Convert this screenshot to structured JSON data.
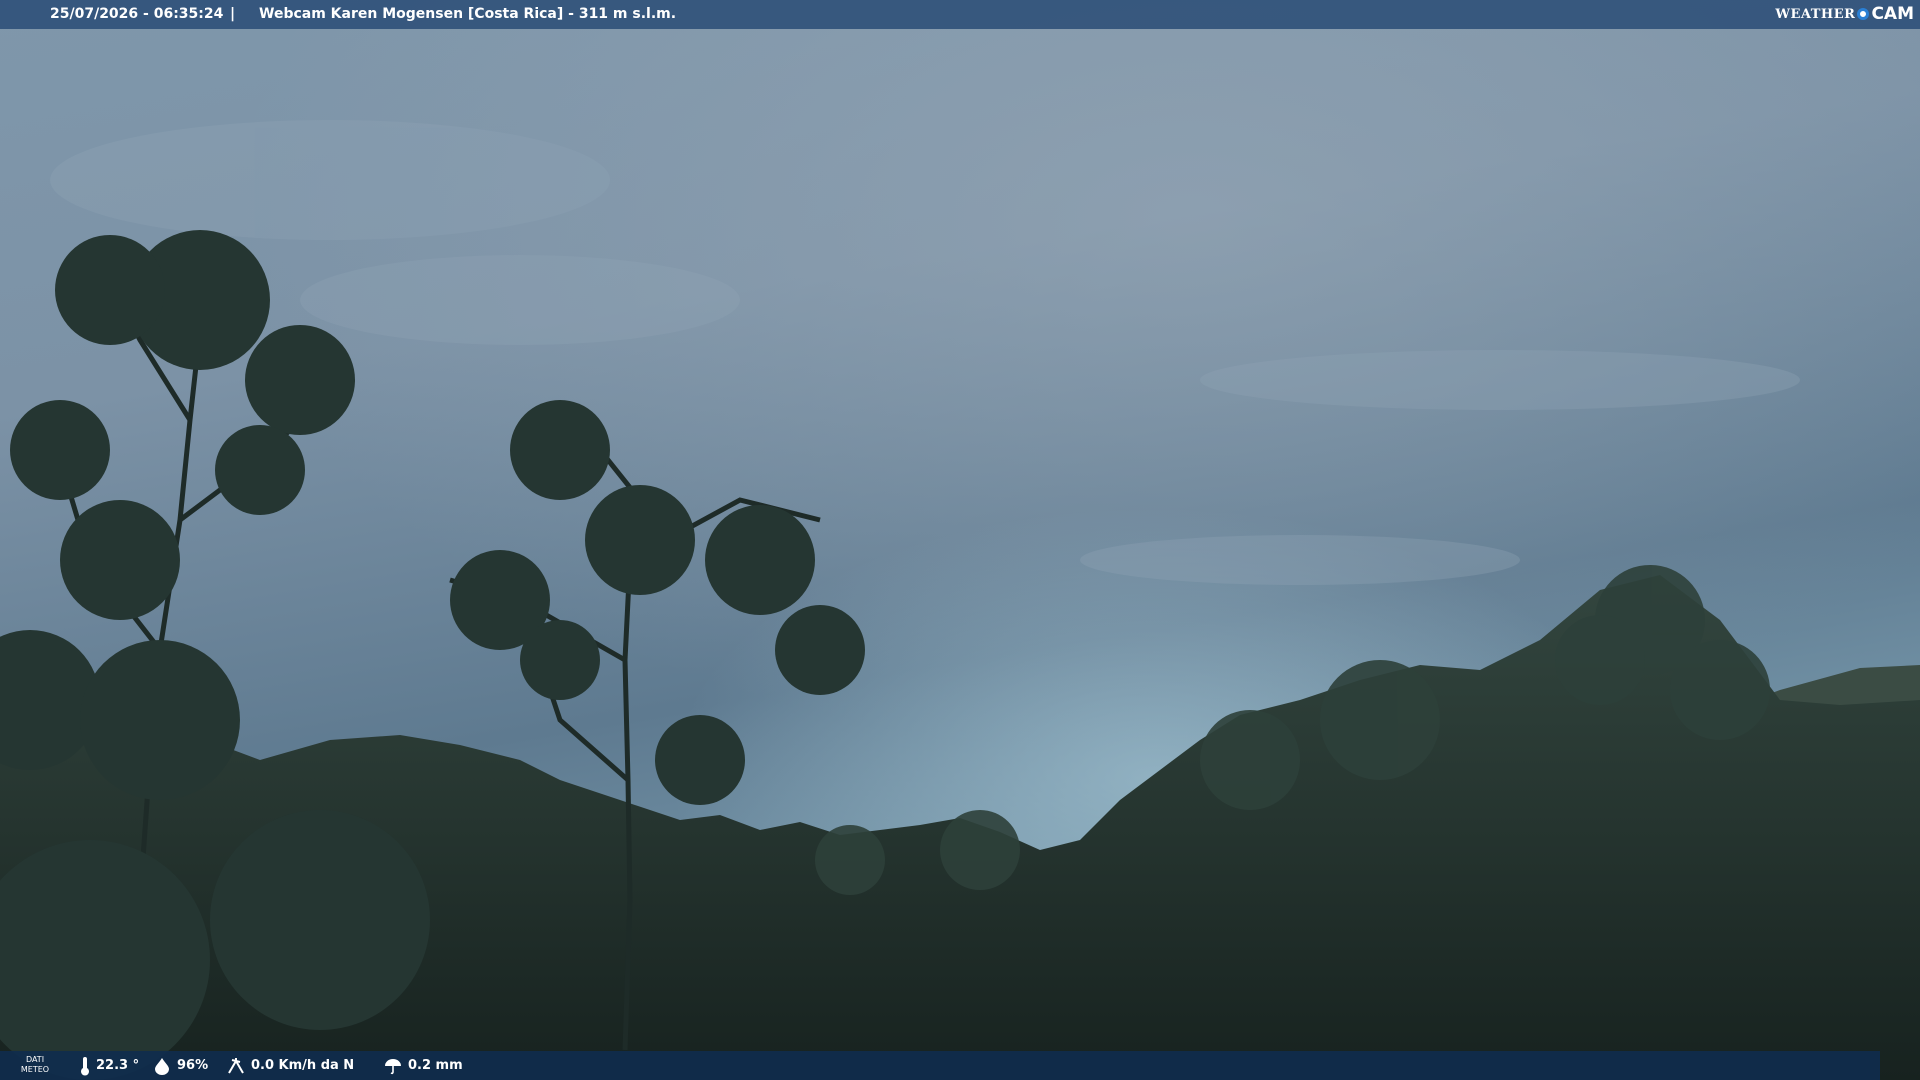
{
  "header": {
    "timestamp": "25/07/2026 - 06:35:24",
    "separator": "|",
    "title": "Webcam Karen Mogensen [Costa Rica]  - 311 m s.l.m."
  },
  "logo": {
    "weather": "WEATHER",
    "cam": "CAM"
  },
  "weather_bar": {
    "label_line1": "DATI",
    "label_line2": "METEO",
    "temperature": "22.3 °",
    "humidity": "96%",
    "wind": "0.0 Km/h da N",
    "rain": "0.2 mm",
    "icons": [
      "thermometer-icon",
      "humidity-icon",
      "wind-icon",
      "rain-icon"
    ]
  },
  "colors": {
    "topbar": "#2c4e78",
    "bottombar": "#102c4e",
    "logo_accent": "#2a7fd4"
  }
}
